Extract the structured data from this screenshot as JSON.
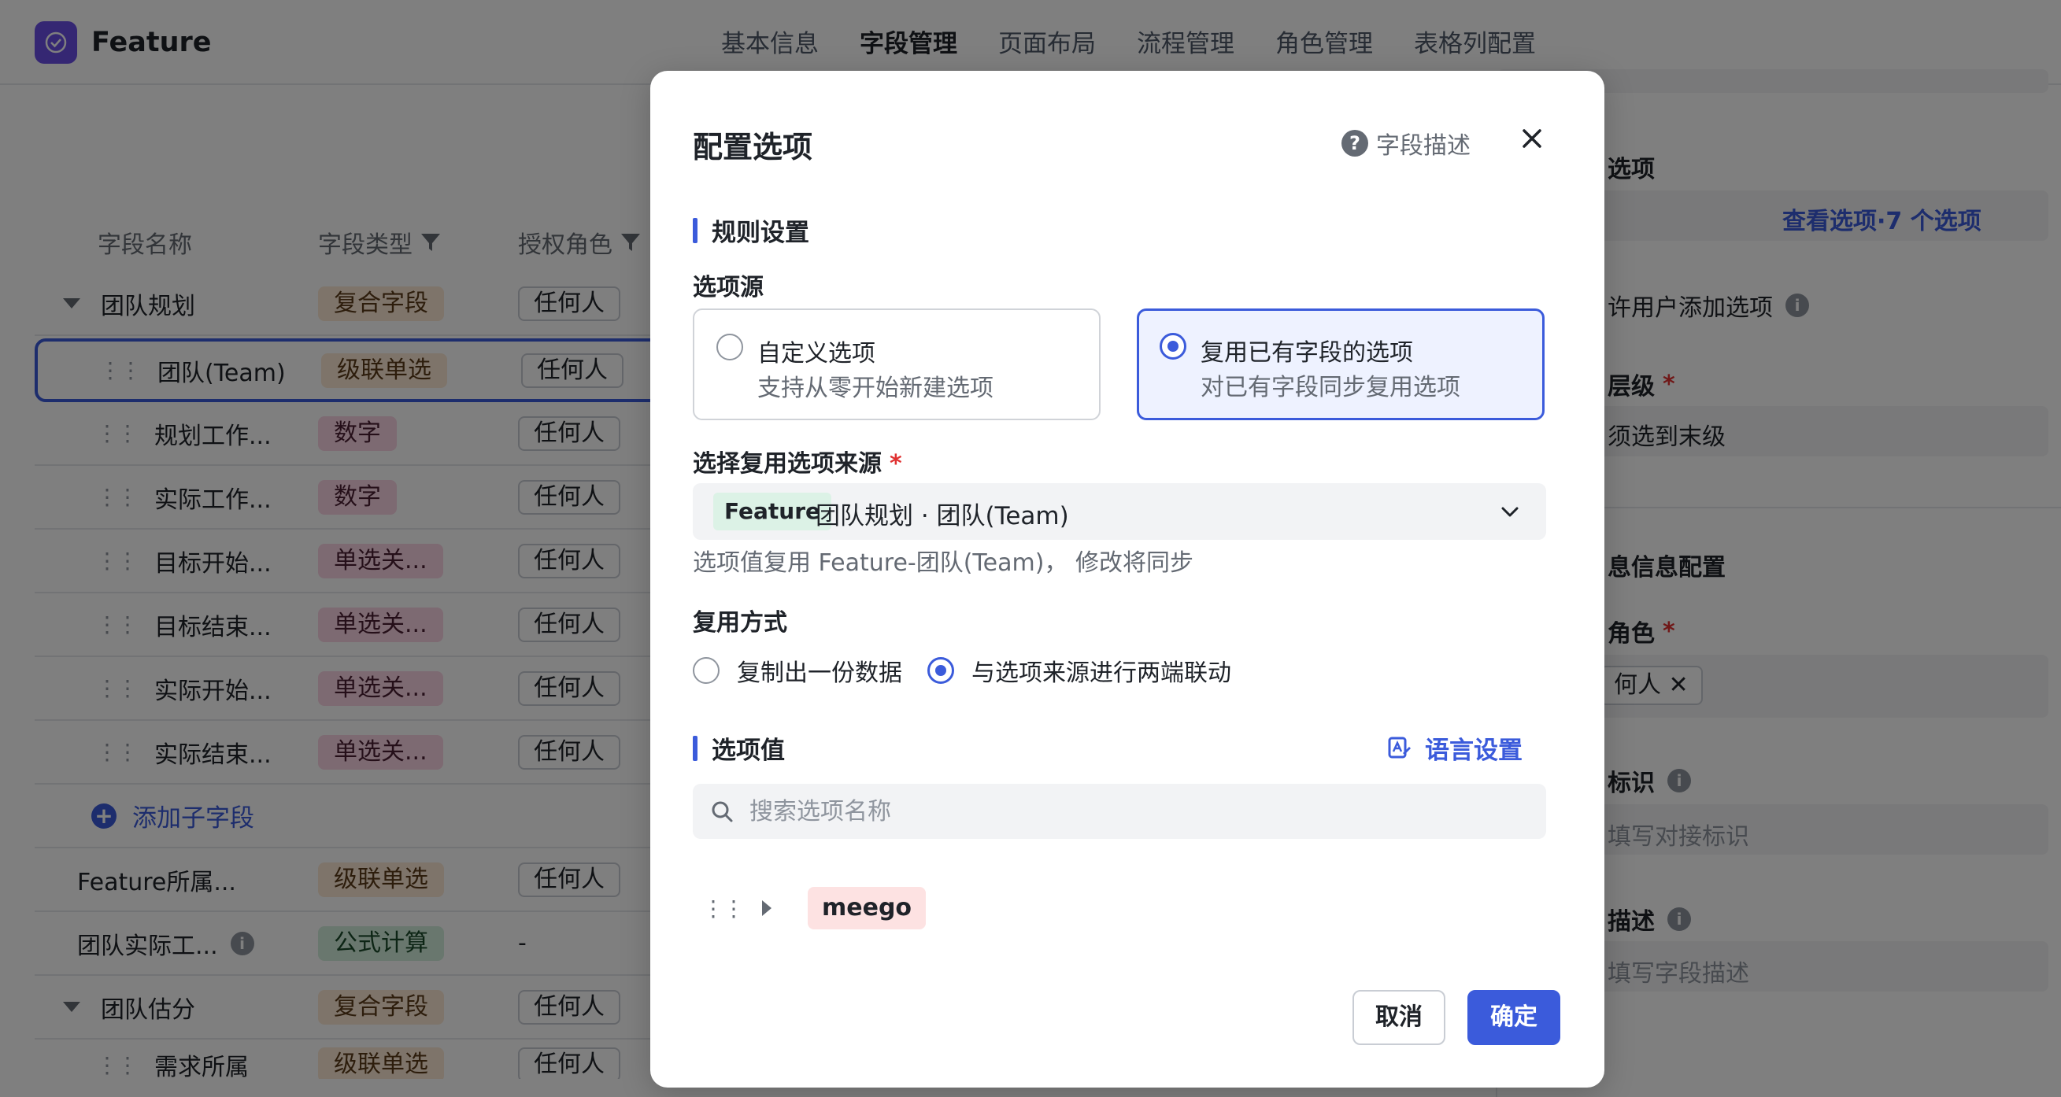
{
  "app": {
    "title": "Feature"
  },
  "nav": {
    "tabs": [
      "基本信息",
      "字段管理",
      "页面布局",
      "流程管理",
      "角色管理",
      "表格列配置"
    ],
    "active_index": 1
  },
  "table": {
    "headers": {
      "name": "字段名称",
      "type": "字段类型",
      "role": "授权角色"
    },
    "rows": [
      {
        "name": "团队规划",
        "type": "复合字段",
        "role": "任何人"
      },
      {
        "name": "团队(Team)",
        "type": "级联单选",
        "role": "任何人"
      },
      {
        "name": "规划工作...",
        "type": "数字",
        "role": "任何人"
      },
      {
        "name": "实际工作...",
        "type": "数字",
        "role": "任何人"
      },
      {
        "name": "目标开始...",
        "type": "单选关...",
        "role": "任何人"
      },
      {
        "name": "目标结束...",
        "type": "单选关...",
        "role": "任何人"
      },
      {
        "name": "实际开始...",
        "type": "单选关...",
        "role": "任何人"
      },
      {
        "name": "实际结束...",
        "type": "单选关...",
        "role": "任何人"
      },
      {
        "name": "添加子字段"
      },
      {
        "name": "Feature所属...",
        "type": "级联单选",
        "role": "任何人"
      },
      {
        "name": "团队实际工...",
        "type": "公式计算",
        "role": "-"
      },
      {
        "name": "团队估分",
        "type": "复合字段",
        "role": "任何人"
      },
      {
        "name": "需求所属",
        "type": "级联单选",
        "role": "任何人"
      }
    ]
  },
  "right_panel": {
    "top_partial": "...",
    "options_label": "选项",
    "view_options_link": "查看选项·7 个选项",
    "allow_add_label": "许用户添加选项",
    "level_label": "层级",
    "level_value": "须选到末级",
    "info_config_label": "息信息配置",
    "role_label": "角色",
    "role_chip": "何人 ✕",
    "ident_label": "标识",
    "ident_placeholder": "填写对接标识",
    "desc_label": "描述",
    "desc_placeholder": "填写字段描述"
  },
  "modal": {
    "title": "配置选项",
    "help_label": "字段描述",
    "rules_section": "规则设置",
    "source_label": "选项源",
    "custom_option": {
      "title": "自定义选项",
      "subtitle": "支持从零开始新建选项",
      "selected": false
    },
    "reuse_option": {
      "title": "复用已有字段的选项",
      "subtitle": "对已有字段同步复用选项",
      "selected": true
    },
    "reuse_source_label": "选择复用选项来源",
    "reuse_source_tag": "Feature",
    "reuse_source_value": "团队规划 · 团队(Team)",
    "reuse_hint": "选项值复用 Feature-团队(Team)， 修改将同步",
    "reuse_mode_label": "复用方式",
    "reuse_mode_copy": "复制出一份数据",
    "reuse_mode_link": "与选项来源进行两端联动",
    "reuse_mode_selected": "link",
    "values_section": "选项值",
    "lang_settings": "语言设置",
    "search_placeholder": "搜索选项名称",
    "option_items": [
      "meego"
    ],
    "cancel": "取消",
    "confirm": "确定"
  },
  "colors": {
    "accent": "#3b5bdb",
    "brand": "#6b4ee6",
    "required": "#e03131"
  }
}
